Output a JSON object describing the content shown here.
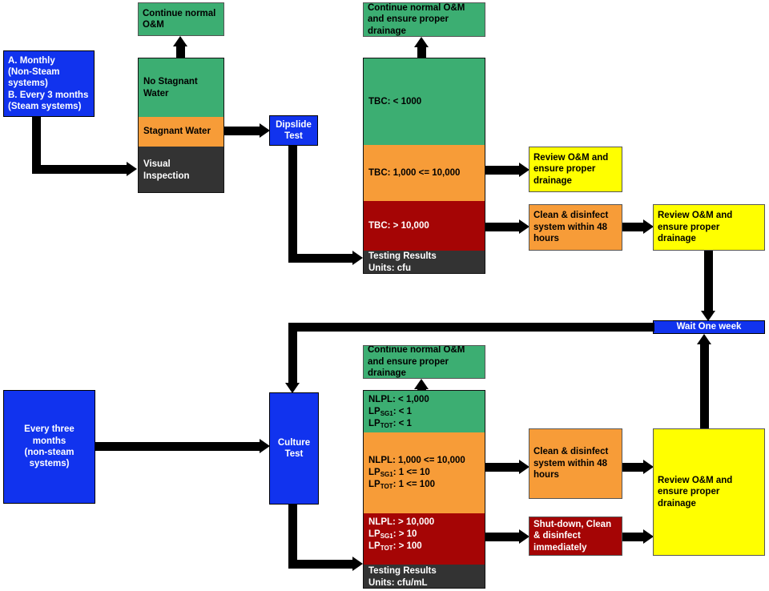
{
  "diagram": {
    "title": "Water system monitoring and response flowchart",
    "colors": {
      "green": "#3cae72",
      "orange": "#f79c38",
      "red": "#a50505",
      "dark": "#333333",
      "blue": "#1133ee",
      "yellow": "#ffff00"
    }
  },
  "top": {
    "schedule": {
      "line1": "A. Monthly",
      "line2": "(Non-Steam",
      "line3": "systems)",
      "line4": "B. Every 3 months",
      "line5": "(Steam systems)"
    },
    "continue_normal_om": "Continue normal O&M",
    "inspection_stack": {
      "no_stagnant": "No Stagnant Water",
      "stagnant": "Stagnant Water",
      "visual": "Visual Inspection"
    },
    "dipslide": {
      "line1": "Dipslide",
      "line2": "Test"
    },
    "continue_normal_om_drainage": "Continue normal O&M and ensure proper drainage",
    "tbc_stack": {
      "low": "TBC: < 1000",
      "mid": "TBC: 1,000 <= 10,000",
      "high": "TBC: > 10,000",
      "results_line1": "Testing Results",
      "results_line2": "Units: cfu"
    },
    "review_om_drainage": "Review O&M and ensure proper drainage",
    "clean_disinfect_48": "Clean & disinfect system within 48 hours",
    "review_om_drainage_2": "Review O&M and ensure proper drainage"
  },
  "wait": {
    "label": "Wait One week"
  },
  "bottom": {
    "schedule": {
      "line1": "Every three months",
      "line2": "(non-steam",
      "line3": "systems)"
    },
    "culture": {
      "line1": "Culture",
      "line2": "Test"
    },
    "continue_normal_om_drainage": "Continue normal O&M and ensure proper drainage",
    "culture_stack": {
      "low": {
        "nlpl": "NLPL: < 1,000",
        "lp_sg1_prefix": "LP",
        "lp_sg1_sub": "SG1",
        "lp_sg1_value": ": < 1",
        "lp_tot_prefix": "LP",
        "lp_tot_sub": "TOT",
        "lp_tot_value": ": < 1"
      },
      "mid": {
        "nlpl": "NLPL: 1,000 <= 10,000",
        "lp_sg1_prefix": "LP",
        "lp_sg1_sub": "SG1",
        "lp_sg1_value": ": 1 <= 10",
        "lp_tot_prefix": "LP",
        "lp_tot_sub": "TOT",
        "lp_tot_value": ": 1 <= 100"
      },
      "high": {
        "nlpl": "NLPL: > 10,000",
        "lp_sg1_prefix": "LP",
        "lp_sg1_sub": "SG1",
        "lp_sg1_value": ": > 10",
        "lp_tot_prefix": "LP",
        "lp_tot_sub": "TOT",
        "lp_tot_value": ": > 100"
      },
      "results_line1": "Testing Results",
      "results_line2": "Units: cfu/mL"
    },
    "clean_disinfect_48": "Clean & disinfect system within 48 hours",
    "shutdown_clean": "Shut-down, Clean & disinfect immediately",
    "review_om_drainage": "Review O&M and ensure proper drainage"
  }
}
